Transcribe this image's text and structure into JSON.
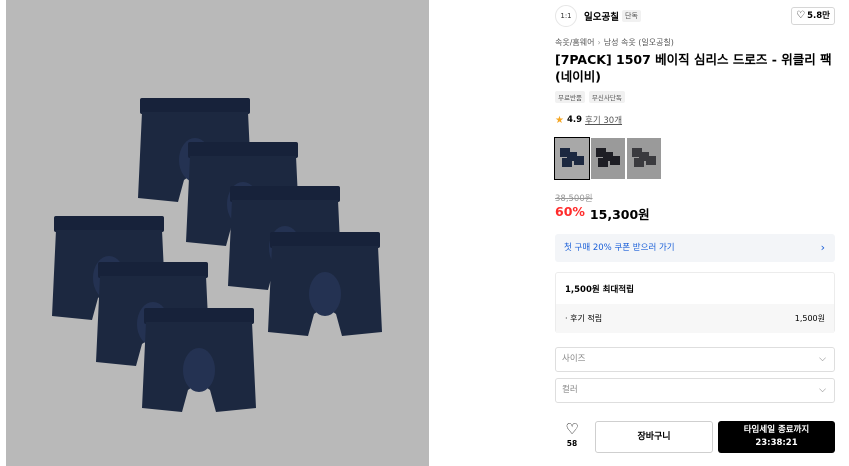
{
  "brand": {
    "logo_text": "1:1",
    "name": "일오공칠",
    "tag": "단독",
    "likes": "5.8만"
  },
  "breadcrumb": [
    "속옷/홈웨어",
    "남성 속옷 (일오공칠)"
  ],
  "product": {
    "title": "[7PACK] 1507 베이직 심리스 드로즈 - 위클리 팩(네이비)",
    "tags": [
      "무료반품",
      "무신사단독"
    ],
    "rating": "4.9",
    "review_text": "후기 30개",
    "thumbnail_count": 3,
    "original_price": "38,500원",
    "discount": "60%",
    "price": "15,300원"
  },
  "coupon": {
    "text": "첫 구매 20% 쿠폰 받으러 가기"
  },
  "points": {
    "header": "1,500원 최대적립",
    "row_label": "· 후기 적립",
    "row_value": "1,500원"
  },
  "options": {
    "size_placeholder": "사이즈",
    "color_placeholder": "컬러"
  },
  "actions": {
    "wish_count": "58",
    "cart_label": "장바구니",
    "buy_line1": "타임세일 종료까지",
    "buy_line2": "23:38:21"
  },
  "colors": {
    "image_bg": "#b9b9b9",
    "garment": "#1c2840",
    "discount": "#ff2b2b",
    "coupon_text": "#1a5fd8",
    "buy_button": "#000000"
  },
  "icons": [
    "heart-icon",
    "chevron-right-icon",
    "chevron-down-icon",
    "star-icon",
    "brand-logo-icon"
  ]
}
